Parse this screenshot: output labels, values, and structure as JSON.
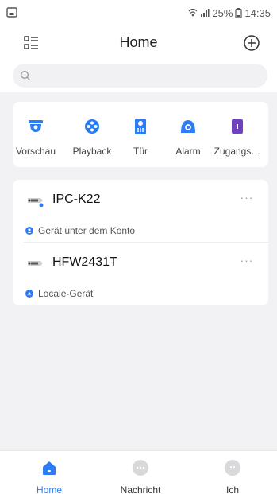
{
  "status_bar": {
    "battery": "25%",
    "time": "14:35"
  },
  "header": {
    "title": "Home",
    "menu_icon": "grid-list-icon",
    "add_icon": "add-circle-icon"
  },
  "search": {
    "placeholder": "",
    "value": "",
    "icon": "search-icon"
  },
  "quick_actions": [
    {
      "label": "Vorschau",
      "icon": "dome-camera-icon",
      "color": "#2b7cf6"
    },
    {
      "label": "Playback",
      "icon": "film-reel-icon",
      "color": "#2b7cf6"
    },
    {
      "label": "Tür",
      "icon": "door-intercom-icon",
      "color": "#2b7cf6"
    },
    {
      "label": "Alarm",
      "icon": "alarm-icon",
      "color": "#2b7cf6"
    },
    {
      "label": "Zugangs…",
      "icon": "access-control-icon",
      "color": "#6f42c1"
    }
  ],
  "devices": [
    {
      "name": "IPC-K22",
      "subtitle": "Gerät unter dem Konto",
      "more": "···"
    },
    {
      "name": "HFW2431T",
      "subtitle": "Locale-Gerät",
      "more": "···"
    }
  ],
  "tabs": [
    {
      "label": "Home",
      "icon": "home-icon",
      "active": true
    },
    {
      "label": "Nachricht",
      "icon": "message-icon",
      "active": false
    },
    {
      "label": "Ich",
      "icon": "profile-icon",
      "active": false
    }
  ],
  "colors": {
    "accent": "#2b7cf6",
    "background": "#f2f2f4",
    "card": "#ffffff"
  }
}
